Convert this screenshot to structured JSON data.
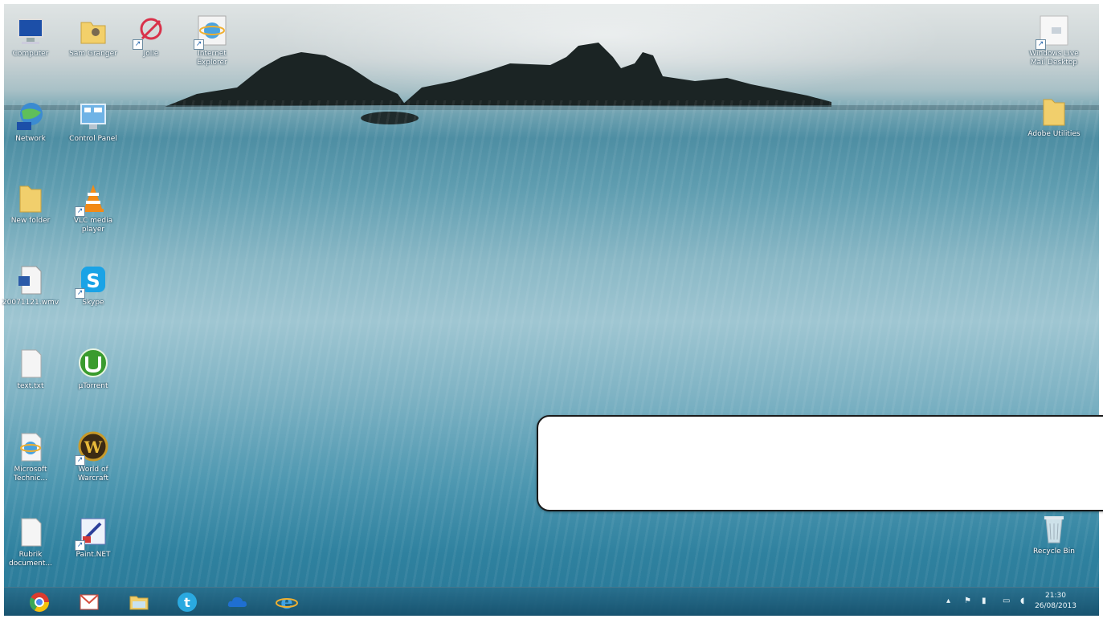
{
  "desktop": {
    "icons_left": [
      {
        "label": "Computer",
        "icon": "computer-icon"
      },
      {
        "label": "Sam Granger",
        "icon": "user-folder-icon"
      },
      {
        "label": "Jolie",
        "icon": "app-shortcut-icon"
      },
      {
        "label": "Internet Explorer",
        "icon": "internet-explorer-icon"
      },
      {
        "label": "Network",
        "icon": "network-icon"
      },
      {
        "label": "Control Panel",
        "icon": "control-panel-icon"
      },
      {
        "label": "New folder",
        "icon": "folder-icon"
      },
      {
        "label": "VLC media player",
        "icon": "vlc-icon"
      },
      {
        "label": "20071121.wmv",
        "icon": "document-icon"
      },
      {
        "label": "Skype",
        "icon": "skype-icon"
      },
      {
        "label": "text.txt",
        "icon": "blank-file-icon"
      },
      {
        "label": "µTorrent",
        "icon": "utorrent-icon"
      },
      {
        "label": "Microsoft Technic...",
        "icon": "ie-document-icon"
      },
      {
        "label": "World of Warcraft",
        "icon": "warcraft-icon"
      },
      {
        "label": "Rubrik document...",
        "icon": "blank-file-icon"
      },
      {
        "label": "Paint.NET",
        "icon": "paint-net-icon"
      }
    ],
    "icons_right": [
      {
        "label": "Windows Live Mail Desktop",
        "icon": "mail-shortcut-icon"
      },
      {
        "label": "Adobe Utilities",
        "icon": "folder-icon"
      },
      {
        "label": "Recycle Bin",
        "icon": "recycle-bin-icon"
      }
    ]
  },
  "taskbar": {
    "pinned": [
      {
        "name": "Google Chrome",
        "icon": "chrome-icon"
      },
      {
        "name": "Gmail",
        "icon": "gmail-icon"
      },
      {
        "name": "File Explorer",
        "icon": "file-explorer-icon"
      },
      {
        "name": "Twitter",
        "icon": "twitter-icon"
      },
      {
        "name": "SkyDrive",
        "icon": "cloud-icon"
      },
      {
        "name": "Internet Explorer",
        "icon": "internet-explorer-icon"
      }
    ],
    "tray": {
      "time": "21:30",
      "date": "26/08/2013"
    }
  },
  "colors": {
    "taskbar": "#1f6a8c",
    "sea": "#4e8ea3"
  }
}
